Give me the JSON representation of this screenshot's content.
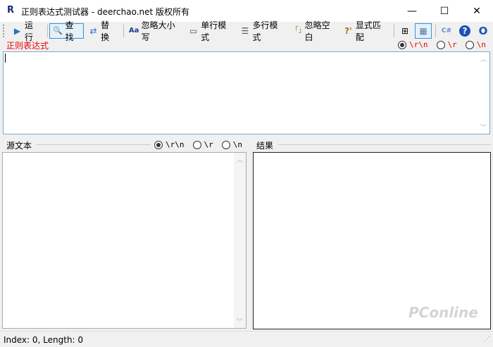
{
  "window": {
    "icon": "R",
    "title": "正则表达式测试器 - deerchao.net 版权所有",
    "minimize": "—",
    "maximize": "☐",
    "close": "✕"
  },
  "toolbar": [
    {
      "label": "运行",
      "icon": "play-icon",
      "glyph": "▶"
    },
    {
      "label": "查找",
      "icon": "magnifier-icon",
      "glyph": "🔍",
      "active": true
    },
    {
      "label": "替换",
      "icon": "replace-icon",
      "glyph": "⇄"
    },
    {
      "label": "忽略大小写",
      "icon": "case-icon",
      "glyph": "Aa"
    },
    {
      "label": "单行模式",
      "icon": "singleline-icon",
      "glyph": "▭"
    },
    {
      "label": "多行模式",
      "icon": "multiline-icon",
      "glyph": "☰"
    },
    {
      "label": "忽略空白",
      "icon": "brackets-icon",
      "glyph": "「」"
    },
    {
      "label": "显式匹配",
      "icon": "explicit-icon",
      "glyph": "?'"
    }
  ],
  "toolbar_icons": [
    "tree-view-icon",
    "grid-view-icon",
    "csharp-icon",
    "help-icon",
    "circle-icon"
  ],
  "regex": {
    "label": "正则表达式",
    "value": "",
    "options": [
      "\\r\\n",
      "\\r",
      "\\n"
    ],
    "selected": 0
  },
  "source": {
    "label": "源文本",
    "value": "",
    "options": [
      "\\r\\n",
      "\\r",
      "\\n"
    ],
    "selected": 0
  },
  "result": {
    "label": "结果"
  },
  "status": "Index: 0, Length: 0",
  "watermark": "PConline"
}
